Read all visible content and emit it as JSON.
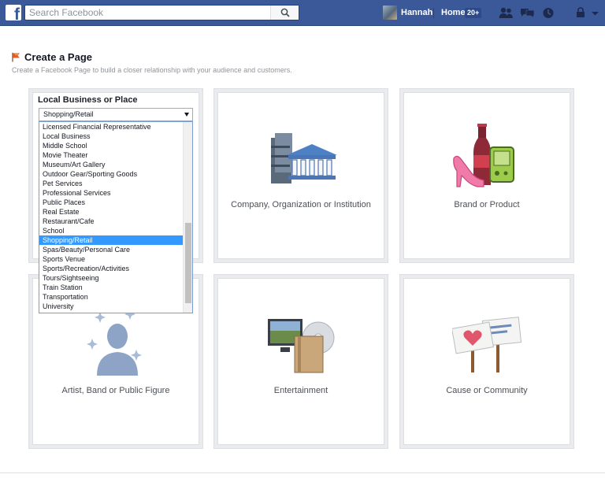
{
  "topbar": {
    "search_placeholder": "Search Facebook",
    "user_name": "Hannah",
    "home_label": "Home",
    "home_badge": "20+"
  },
  "header": {
    "title": "Create a Page",
    "subtitle": "Create a Facebook Page to build a closer relationship with your audience and customers."
  },
  "local_business": {
    "title": "Local Business or Place",
    "selected_value": "Shopping/Retail",
    "options": [
      "Licensed Financial Representative",
      "Local Business",
      "Middle School",
      "Movie Theater",
      "Museum/Art Gallery",
      "Outdoor Gear/Sporting Goods",
      "Pet Services",
      "Professional Services",
      "Public Places",
      "Real Estate",
      "Restaurant/Cafe",
      "School",
      "Shopping/Retail",
      "Spas/Beauty/Personal Care",
      "Sports Venue",
      "Sports/Recreation/Activities",
      "Tours/Sightseeing",
      "Train Station",
      "Transportation",
      "University"
    ],
    "selected_index": 12,
    "scroll_thumb_start_fraction": 0.53,
    "scroll_thumb_end_fraction": 0.95
  },
  "cards": [
    {
      "id": "company",
      "label": "Company, Organization or Institution",
      "icon": "building-icon"
    },
    {
      "id": "brand",
      "label": "Brand or Product",
      "icon": "products-icon"
    },
    {
      "id": "artist",
      "label": "Artist, Band or Public Figure",
      "icon": "person-icon"
    },
    {
      "id": "entertainment",
      "label": "Entertainment",
      "icon": "media-icon"
    },
    {
      "id": "cause",
      "label": "Cause or Community",
      "icon": "signs-icon"
    }
  ],
  "colors": {
    "facebook_blue": "#3b5998",
    "selection_blue": "#3399ff",
    "card_border": "#dddfe2"
  }
}
